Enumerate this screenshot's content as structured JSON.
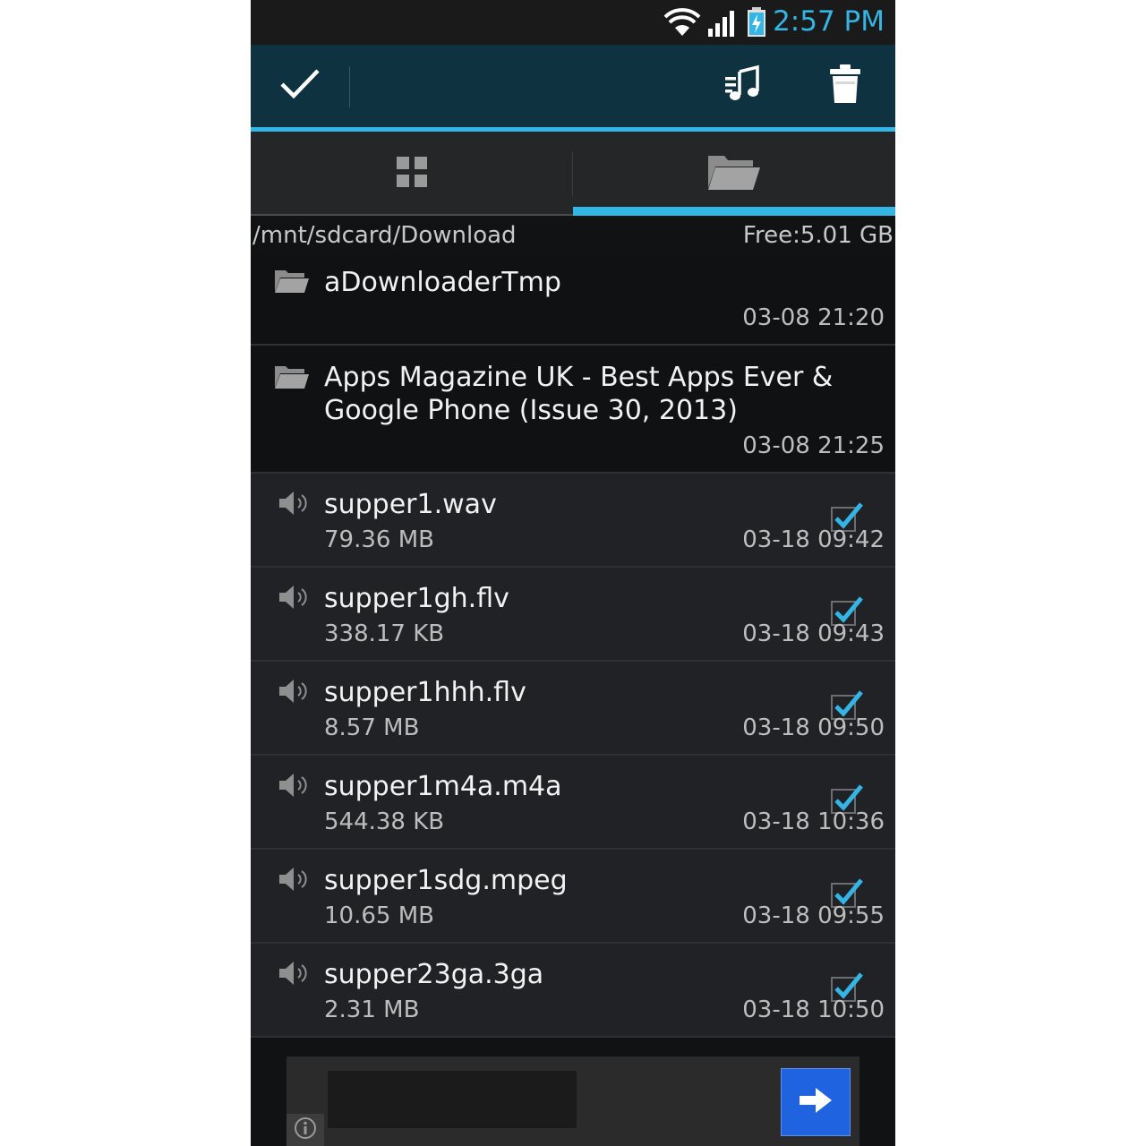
{
  "status_bar": {
    "time": "2:57 PM",
    "icons": [
      "wifi-icon",
      "signal-icon",
      "battery-charging-icon"
    ],
    "accent_color": "#33b5e5"
  },
  "action_bar": {
    "done_icon": "checkmark-icon",
    "actions": [
      "music-playlist-icon",
      "trash-icon"
    ]
  },
  "tabs": [
    {
      "icon": "grid-icon",
      "selected": false
    },
    {
      "icon": "folder-icon",
      "selected": true
    }
  ],
  "path_bar": {
    "path": "/mnt/sdcard/Download",
    "free": "Free:5.01 GB"
  },
  "folders": [
    {
      "title_lines": [
        "aDownloaderTmp"
      ],
      "date": "03-08 21:20"
    },
    {
      "title_lines": [
        "Apps Magazine UK - Best Apps Ever &",
        "Google Phone (Issue 30, 2013)"
      ],
      "date": "03-08 21:25"
    }
  ],
  "files": [
    {
      "name": "supper1.wav",
      "size": "79.36 MB",
      "date": "03-18 09:42",
      "checked": true
    },
    {
      "name": "supper1gh.flv",
      "size": "338.17 KB",
      "date": "03-18 09:43",
      "checked": true
    },
    {
      "name": "supper1hhh.flv",
      "size": "8.57 MB",
      "date": "03-18 09:50",
      "checked": true
    },
    {
      "name": "supper1m4a.m4a",
      "size": "544.38 KB",
      "date": "03-18 10:36",
      "checked": true
    },
    {
      "name": "supper1sdg.mpeg",
      "size": "10.65 MB",
      "date": "03-18 09:55",
      "checked": true
    },
    {
      "name": "supper23ga.3ga",
      "size": "2.31 MB",
      "date": "03-18 10:50",
      "checked": true
    }
  ],
  "ad_bar": {
    "info_icon": "info-icon",
    "go_icon": "arrow-right-icon",
    "go_color": "#1f63e0"
  }
}
